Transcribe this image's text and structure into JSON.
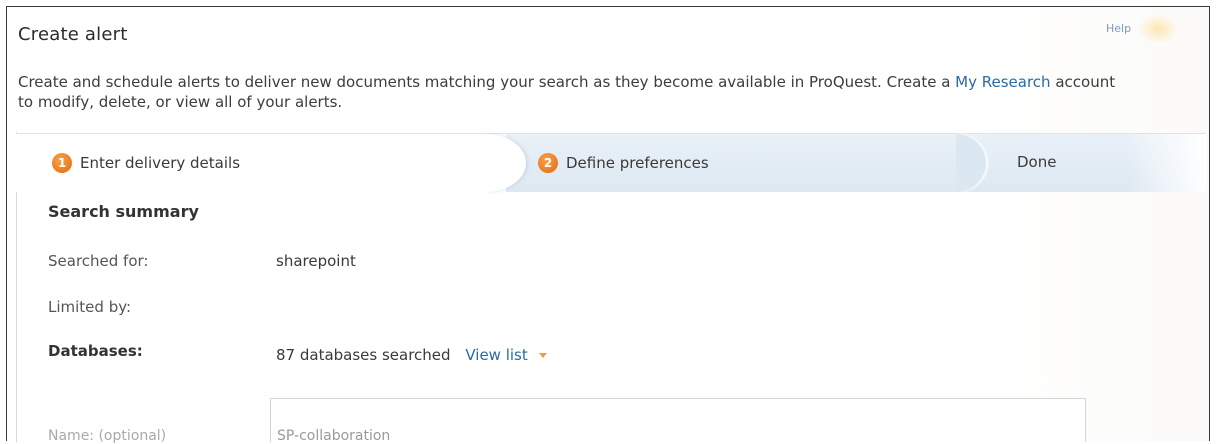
{
  "dialog": {
    "title": "Create alert",
    "help_label": "Help",
    "intro_prefix": "Create and schedule alerts to deliver new documents matching your search as they become available in ProQuest. Create a ",
    "intro_link": "My Research",
    "intro_suffix": " account to modify, delete, or view all of your alerts."
  },
  "steps": [
    {
      "number": "1",
      "label": "Enter delivery details",
      "state": "active"
    },
    {
      "number": "2",
      "label": "Define preferences",
      "state": "upcoming"
    },
    {
      "label": "Done",
      "state": "upcoming"
    }
  ],
  "summary": {
    "heading": "Search summary",
    "searched_for_label": "Searched for:",
    "searched_for_value": "sharepoint",
    "limited_by_label": "Limited by:",
    "databases_label": "Databases:",
    "databases_value": "87 databases searched",
    "view_list_label": "View list"
  },
  "name_field": {
    "label": "Name: (optional)",
    "value": "SP-collaboration"
  },
  "colors": {
    "accent_orange": "#ea7a1c",
    "link_blue": "#2a6aa7",
    "tab_bg": "#dde8f2"
  }
}
